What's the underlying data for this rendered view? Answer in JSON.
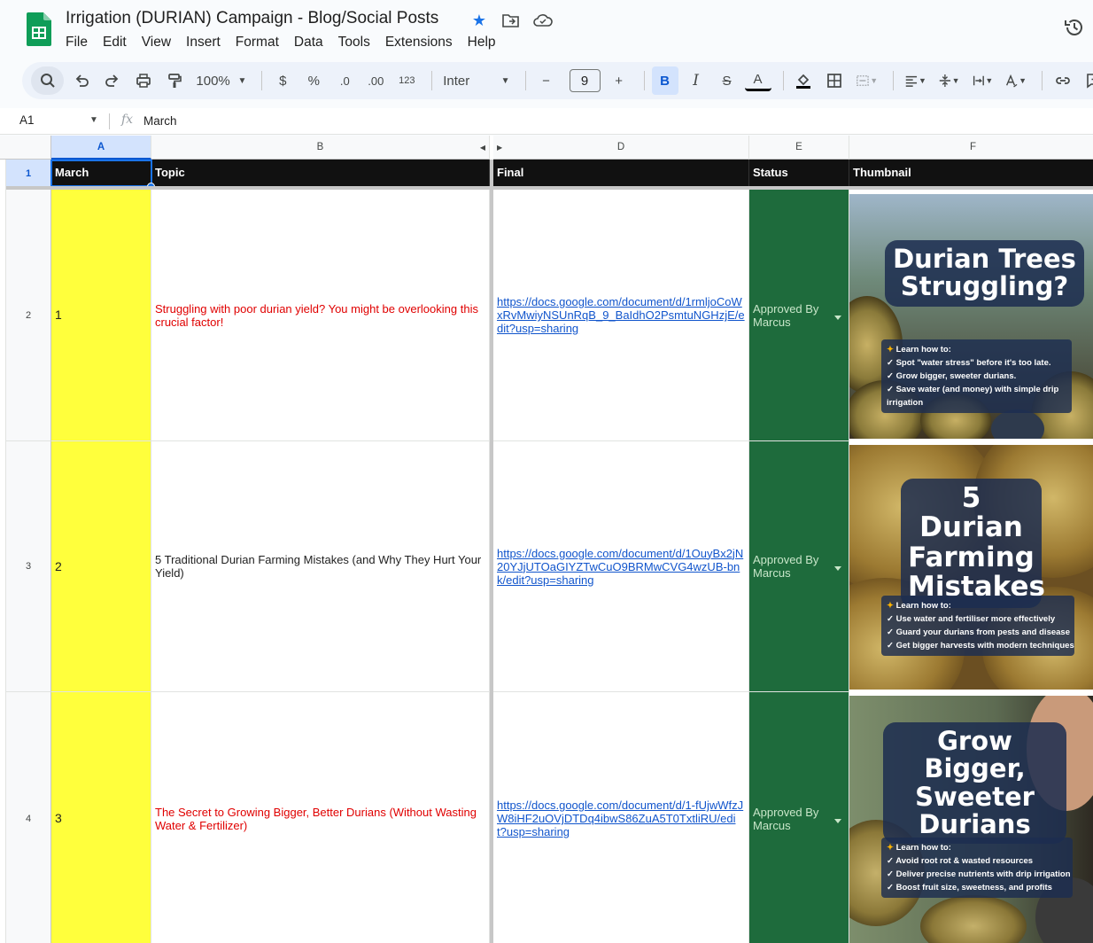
{
  "titlebar": {
    "doc_title": "Irrigation (DURIAN) Campaign - Blog/Social Posts",
    "menu": [
      "File",
      "Edit",
      "View",
      "Insert",
      "Format",
      "Data",
      "Tools",
      "Extensions",
      "Help"
    ]
  },
  "toolbar": {
    "zoom": "100%",
    "currency": "$",
    "percent": "%",
    "decrease_decimal": ".0",
    "increase_decimal": ".00",
    "number_format": "123",
    "font": "Inter",
    "minus": "−",
    "font_size": "9",
    "plus": "+",
    "bold": "B",
    "italic": "I",
    "strike": "S",
    "text_color": "A"
  },
  "formula_bar": {
    "cell_ref": "A1",
    "fx": "fx",
    "value": "March"
  },
  "columns": [
    "A",
    "B",
    "D",
    "E",
    "F"
  ],
  "header_row": {
    "row_number": "1",
    "march": "March",
    "topic": "Topic",
    "final": "Final",
    "status": "Status",
    "thumbnail": "Thumbnail"
  },
  "rows": [
    {
      "row_number": "2",
      "index": "1",
      "topic": "Struggling with poor durian yield? You might be overlooking this crucial factor!",
      "link": "https://docs.google.com/document/d/1rmljoCoWxRvMwiyNSUnRqB_9_BaIdhO2PsmtuNGHzjE/edit?usp=sharing",
      "status": "Approved By Marcus",
      "thumb_title": "Durian Trees Struggling?",
      "thumb_points": [
        "Learn how to:",
        "✓ Spot \"water stress\" before it's too late.",
        "✓ Grow bigger, sweeter durians.",
        "✓ Save water (and money) with simple drip",
        "irrigation"
      ]
    },
    {
      "row_number": "3",
      "index": "2",
      "topic": "5 Traditional Durian Farming Mistakes (and Why They Hurt Your Yield)",
      "link": "https://docs.google.com/document/d/1OuyBx2jN20YJjUTOaGIYZTwCuO9BRMwCVG4wzUB-bnk/edit?usp=sharing",
      "status": "Approved By Marcus",
      "thumb_title": "5 Durian Farming Mistakes",
      "thumb_points": [
        "Learn how to:",
        "✓ Use water and fertiliser more effectively",
        "✓ Guard your durians from pests and disease",
        "✓ Get bigger harvests with modern techniques"
      ]
    },
    {
      "row_number": "4",
      "index": "3",
      "topic": "The Secret to Growing Bigger, Better Durians (Without Wasting Water & Fertilizer)",
      "link": "https://docs.google.com/document/d/1-fUjwWfzJW8iHF2uOVjDTDq4ibwS86ZuA5T0TxtliRU/edit?usp=sharing",
      "status": "Approved By Marcus",
      "thumb_title": "Grow Bigger, Sweeter Durians",
      "thumb_points": [
        "Learn how to:",
        "✓ Avoid root rot & wasted resources",
        "✓ Deliver precise nutrients with drip irrigation",
        "✓ Boost fruit size, sweetness, and profits"
      ]
    }
  ],
  "colors": {
    "yellow_fill": "#ffff3c",
    "status_fill": "#1e6b3c",
    "header_fill": "#111111",
    "topic_red": "#e00000",
    "link_blue": "#1155cc"
  }
}
